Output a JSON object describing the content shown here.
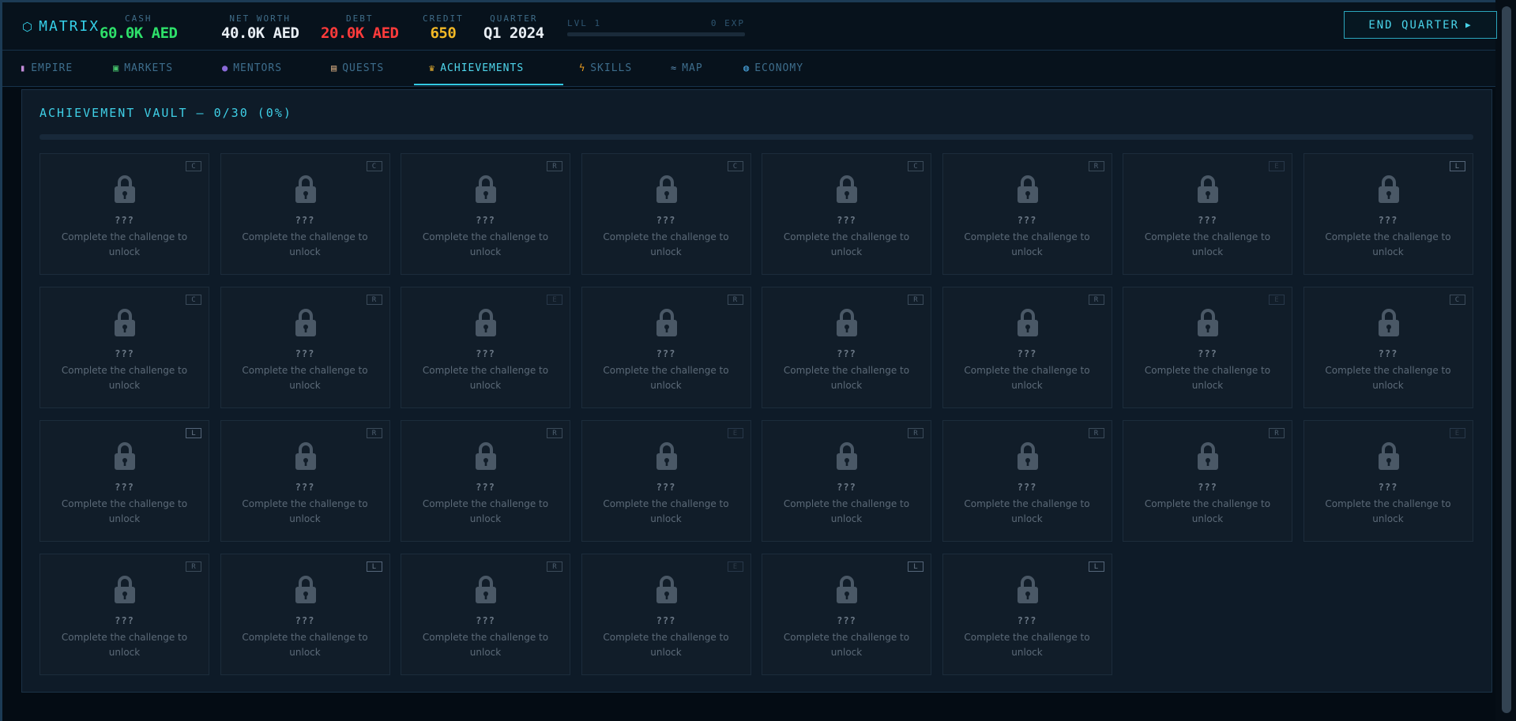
{
  "app": {
    "logo": "MATRIX",
    "logo_icon": "hexagon-icon"
  },
  "stats": [
    {
      "label": "CASH",
      "value": "60.0K AED",
      "color": "#2ee06a"
    },
    {
      "label": "NET WORTH",
      "value": "40.0K AED",
      "color": "#e8eef4"
    },
    {
      "label": "DEBT",
      "value": "20.0K AED",
      "color": "#ff3b3b"
    },
    {
      "label": "CREDIT",
      "value": "650",
      "color": "#f2b826"
    },
    {
      "label": "QUARTER",
      "value": "Q1 2024",
      "color": "#e8eef4"
    }
  ],
  "level": {
    "label": "LVL 1",
    "exp": "0 EXP",
    "progress": 0
  },
  "end_button": {
    "label": "END QUARTER",
    "icon": "play-icon"
  },
  "tabs": [
    {
      "label": "EMPIRE",
      "icon": "chart-icon"
    },
    {
      "label": "MARKETS",
      "icon": "trend-icon"
    },
    {
      "label": "MENTORS",
      "icon": "people-icon"
    },
    {
      "label": "QUESTS",
      "icon": "clipboard-icon"
    },
    {
      "label": "ACHIEVEMENTS",
      "icon": "trophy-icon",
      "active": true
    },
    {
      "label": "SKILLS",
      "icon": "bolt-icon"
    },
    {
      "label": "MAP",
      "icon": "map-icon"
    },
    {
      "label": "ECONOMY",
      "icon": "globe-icon"
    }
  ],
  "vault": {
    "title": "ACHIEVEMENT VAULT — 0/30 (0%)",
    "progress": 0,
    "locked_title": "???",
    "locked_desc": "Complete the challenge to unlock",
    "rarities": [
      "C",
      "C",
      "R",
      "C",
      "C",
      "R",
      "E",
      "L",
      "C",
      "R",
      "E",
      "R",
      "R",
      "R",
      "E",
      "C",
      "L",
      "R",
      "R",
      "E",
      "R",
      "R",
      "R",
      "E",
      "R",
      "L",
      "R",
      "E",
      "L",
      "L"
    ]
  }
}
